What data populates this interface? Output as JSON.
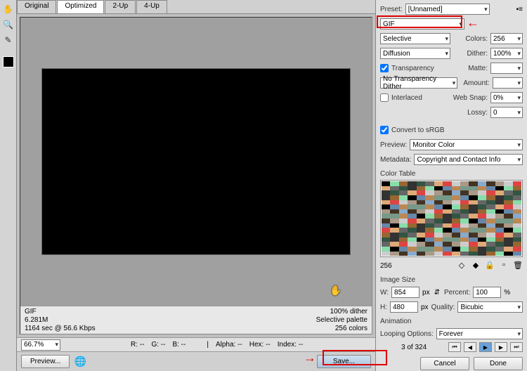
{
  "tabs": [
    "Original",
    "Optimized",
    "2-Up",
    "4-Up"
  ],
  "active_tab": 1,
  "preset": {
    "label": "Preset:",
    "value": "[Unnamed]"
  },
  "format": "GIF",
  "color_reduction": {
    "value": "Selective",
    "colors_label": "Colors:",
    "colors": "256"
  },
  "dither_method": {
    "value": "Diffusion",
    "dither_label": "Dither:",
    "dither": "100%"
  },
  "transparency": {
    "label": "Transparency",
    "checked": true,
    "matte_label": "Matte:",
    "matte": ""
  },
  "no_trans_dither": {
    "value": "No Transparency Dither",
    "amount_label": "Amount:"
  },
  "interlaced": {
    "label": "Interlaced",
    "checked": false,
    "websnap_label": "Web Snap:",
    "websnap": "0%"
  },
  "lossy": {
    "label": "Lossy:",
    "value": "0"
  },
  "convert_srgb": {
    "label": "Convert to sRGB",
    "checked": true
  },
  "preview": {
    "label": "Preview:",
    "value": "Monitor Color"
  },
  "metadata": {
    "label": "Metadata:",
    "value": "Copyright and Contact Info"
  },
  "color_table": {
    "label": "Color Table",
    "count": "256"
  },
  "image_size": {
    "label": "Image Size",
    "w_label": "W:",
    "w": "854",
    "w_unit": "px",
    "h_label": "H:",
    "h": "480",
    "h_unit": "px",
    "percent_label": "Percent:",
    "percent": "100",
    "percent_unit": "%",
    "quality_label": "Quality:",
    "quality": "Bicubic"
  },
  "animation": {
    "label": "Animation",
    "looping_label": "Looping Options:",
    "looping": "Forever",
    "frame": "3 of 324"
  },
  "info": {
    "format": "GIF",
    "size": "6.281M",
    "time": "1164 sec @ 56.6 Kbps",
    "dither": "100% dither",
    "palette": "Selective palette",
    "colors": "256 colors"
  },
  "status": {
    "zoom": "66.7%",
    "r": "R: --",
    "g": "G: --",
    "b": "B: --",
    "alpha": "Alpha: --",
    "hex": "Hex: --",
    "index": "Index: --"
  },
  "buttons": {
    "preview": "Preview...",
    "save": "Save...",
    "cancel": "Cancel",
    "done": "Done"
  }
}
